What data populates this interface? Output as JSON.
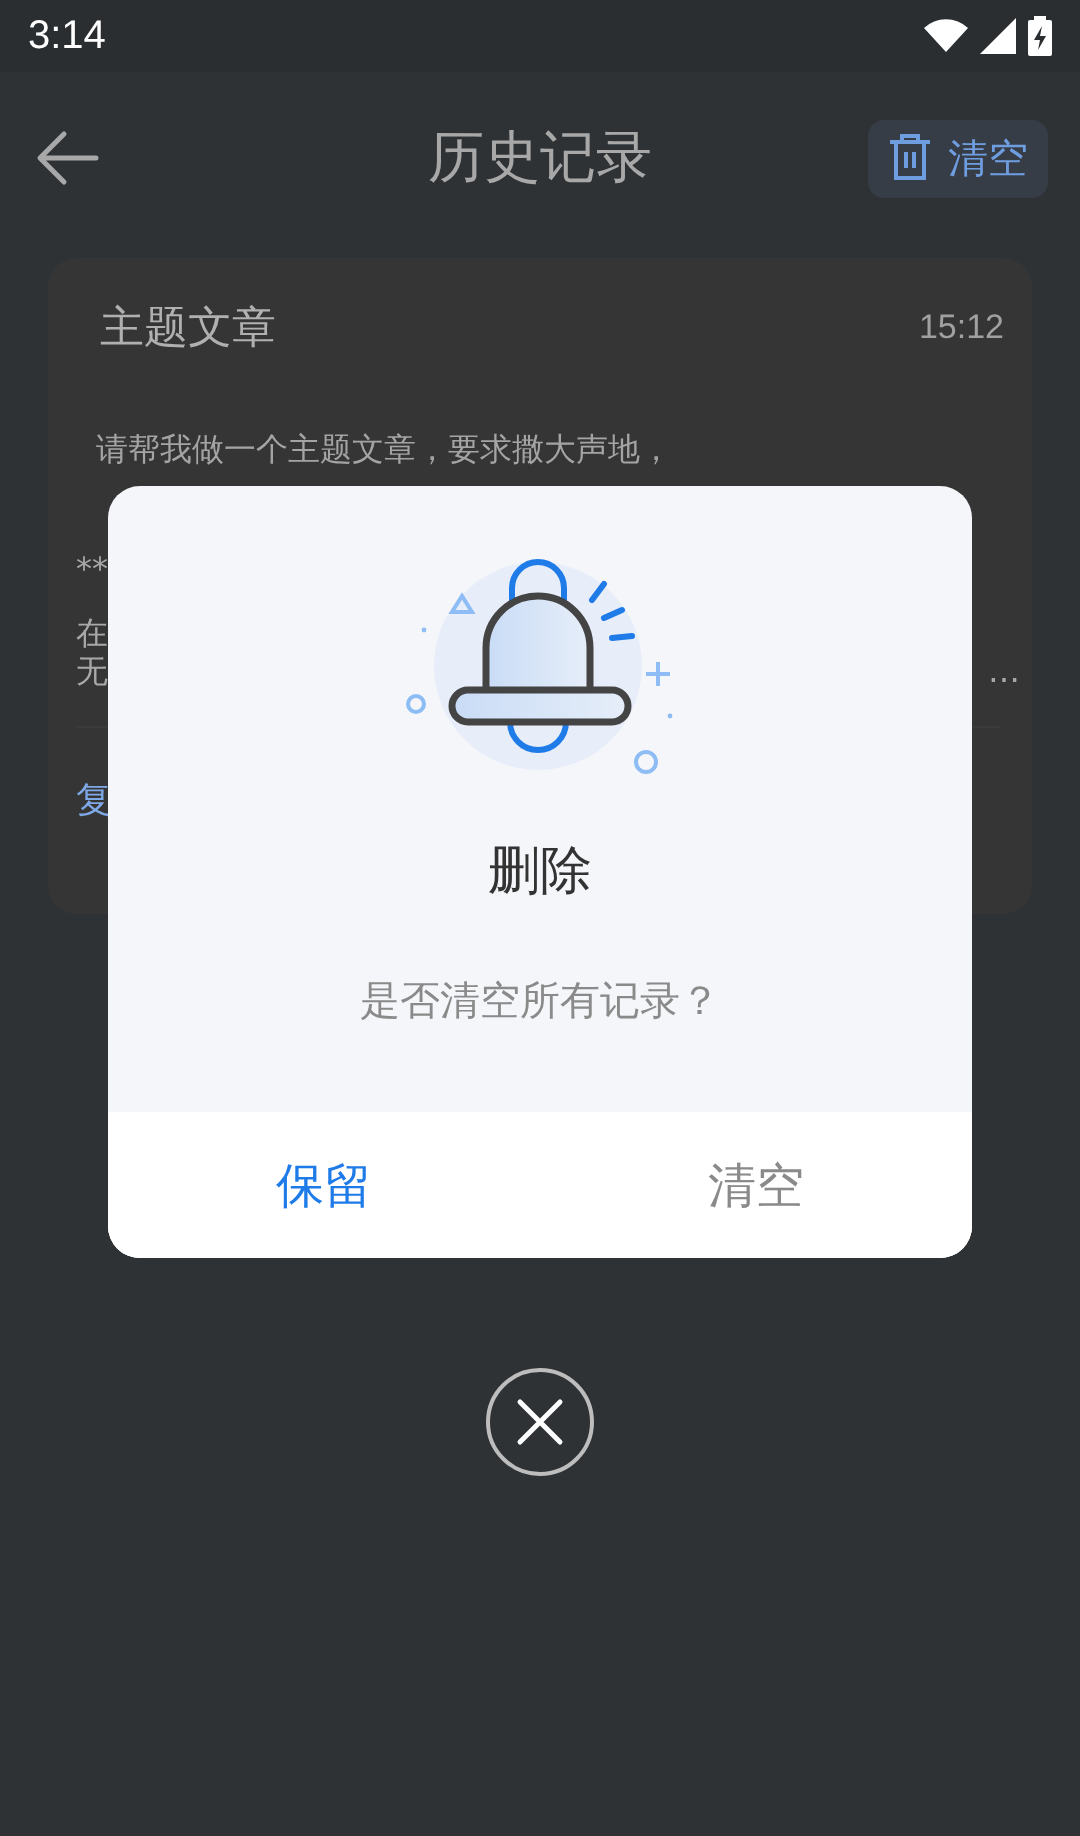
{
  "status_bar": {
    "time": "3:14"
  },
  "header": {
    "title": "历史记录",
    "clear_button": "清空"
  },
  "records": [
    {
      "title": "主题文章",
      "time": "15:12",
      "prompt": "请帮我做一个主题文章，要求撒大声地，",
      "fragments": [
        "**",
        "在",
        "无"
      ],
      "ellipsis": "…",
      "action": "复"
    }
  ],
  "dialog": {
    "title": "删除",
    "message": "是否清空所有记录？",
    "buttons": [
      {
        "label": "保留",
        "kind": "primary"
      },
      {
        "label": "清空",
        "kind": "secondary"
      }
    ]
  }
}
